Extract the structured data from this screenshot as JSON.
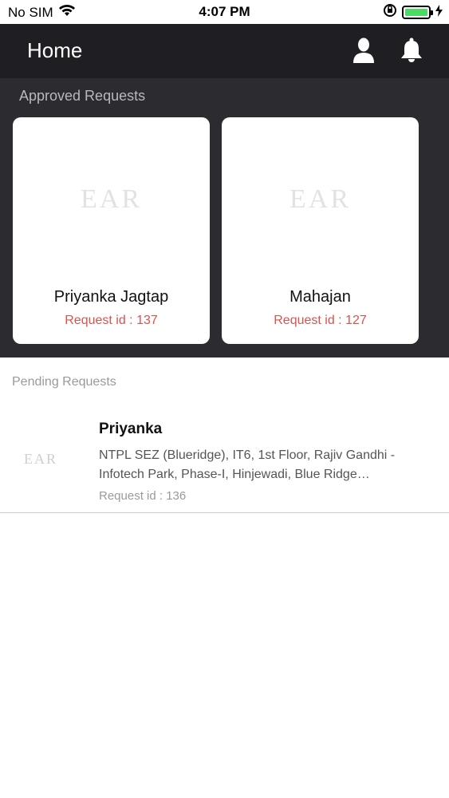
{
  "status_bar": {
    "carrier": "No SIM",
    "time": "4:07 PM",
    "battery_level": 1.0
  },
  "header": {
    "title": "Home",
    "icons": [
      "profile-icon",
      "bell-icon"
    ]
  },
  "approved": {
    "title": "Approved Requests",
    "cards": [
      {
        "logo": "EAR",
        "name": "Priyanka Jagtap",
        "request_id": "Request id : 137"
      },
      {
        "logo": "EAR",
        "name": "Mahajan",
        "request_id": "Request id : 127"
      }
    ]
  },
  "pending": {
    "title": "Pending Requests",
    "items": [
      {
        "logo": "EAR",
        "name": "Priyanka",
        "address": "NTPL SEZ (Blueridge), IT6, 1st Floor, Rajiv Gandhi - Infotech Park, Phase-I, Hinjewadi, Blue Ridge…",
        "request_id": "Request id : 136"
      }
    ]
  },
  "colors": {
    "header_bg": "#1f1e22",
    "section_bg": "#2c2b30",
    "accent_red": "#d9534f",
    "battery_green": "#4cd964"
  }
}
